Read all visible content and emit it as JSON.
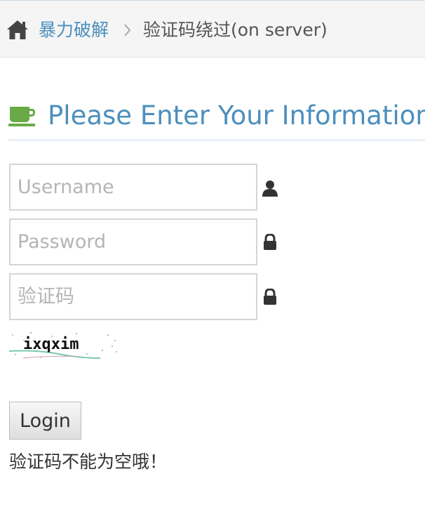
{
  "breadcrumb": {
    "home_icon": "home-icon",
    "link_label": "暴力破解",
    "separator_icon": "chevron-right-icon",
    "current_label": "验证码绕过(on server)"
  },
  "section": {
    "icon": "coffee-icon",
    "title": "Please Enter Your Information"
  },
  "form": {
    "username": {
      "value": "",
      "placeholder": "Username",
      "icon": "user-icon"
    },
    "password": {
      "value": "",
      "placeholder": "Password",
      "icon": "lock-icon"
    },
    "captcha_input": {
      "value": "",
      "placeholder": "验证码",
      "icon": "lock-icon"
    },
    "captcha_image_text": "ixqxim",
    "login_label": "Login",
    "error_message": "验证码不能为空哦！"
  },
  "colors": {
    "accent": "#4c8fbd",
    "icon_dark": "#333333",
    "coffee_green": "#69aa46"
  }
}
